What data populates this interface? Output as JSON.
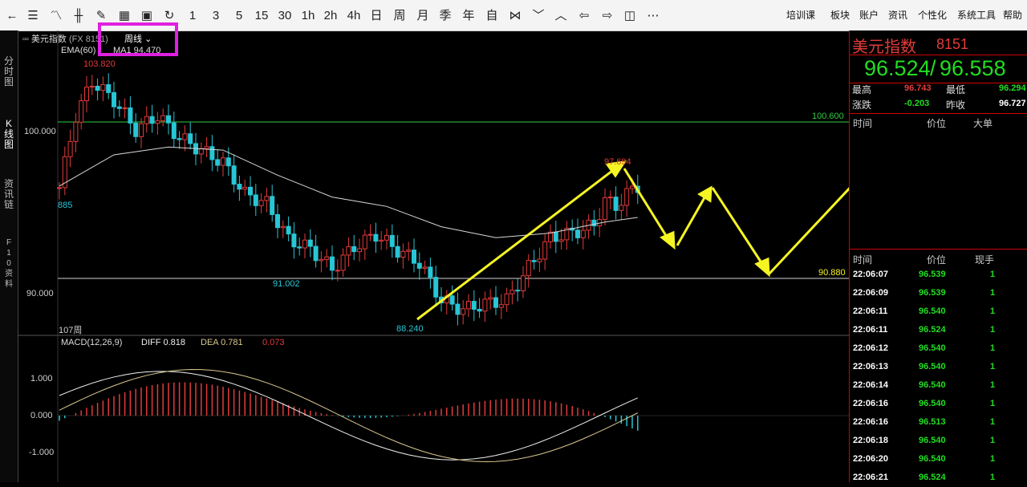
{
  "toolbar": {
    "icons": [
      "back-icon",
      "list-icon",
      "line-icon",
      "candle-icon",
      "draw-icon",
      "layout-icon",
      "save-icon",
      "refresh-icon"
    ],
    "periods": [
      "1",
      "3",
      "5",
      "15",
      "30",
      "1h",
      "2h",
      "4h",
      "日",
      "周",
      "月",
      "季",
      "年",
      "自"
    ],
    "right_menu": [
      "培训课",
      "板块",
      "账户",
      "资讯",
      "个性化",
      "系统工具",
      "帮助"
    ]
  },
  "sidebar": {
    "tabs": [
      "分时图",
      "K线图",
      "资讯链",
      "F10资料"
    ]
  },
  "chart_header": {
    "symbol": "美元指数",
    "code": "(FX 8151)",
    "period": "周线",
    "ema_label": "EMA(60)",
    "ma_label": "MA1 94.470"
  },
  "price_axis": [
    "100.000",
    "90.000"
  ],
  "annotations": {
    "high_label": "103.820",
    "left_label": "885",
    "low1_label": "91.002",
    "low2_label": "88.240",
    "recent_high_label": "97.694",
    "level_high": "100.600",
    "level_low": "90.880",
    "bar_count": "107周"
  },
  "macd": {
    "title": "MACD(12,26,9)",
    "diff": "DIFF 0.818",
    "dea": "DEA 0.781",
    "macd_value": "0.073",
    "axis": [
      "1.000",
      "0.000",
      "-1.000"
    ]
  },
  "quote": {
    "name": "美元指数",
    "code": "8151",
    "bid": "96.524",
    "ask": "96.558",
    "high_label": "最高",
    "high": "96.743",
    "low_label": "最低",
    "low": "96.294",
    "change_label": "涨跌",
    "change": "-0.203",
    "prev_close_label": "昨收",
    "prev_close": "96.727"
  },
  "big_orders": {
    "headers": [
      "时间",
      "价位",
      "大单"
    ]
  },
  "ticks": {
    "headers": [
      "时间",
      "价位",
      "现手"
    ],
    "rows": [
      {
        "time": "22:06:07",
        "price": "96.539",
        "vol": "1"
      },
      {
        "time": "22:06:09",
        "price": "96.539",
        "vol": "1"
      },
      {
        "time": "22:06:11",
        "price": "96.540",
        "vol": "1"
      },
      {
        "time": "22:06:11",
        "price": "96.524",
        "vol": "1"
      },
      {
        "time": "22:06:12",
        "price": "96.540",
        "vol": "1"
      },
      {
        "time": "22:06:13",
        "price": "96.540",
        "vol": "1"
      },
      {
        "time": "22:06:14",
        "price": "96.540",
        "vol": "1"
      },
      {
        "time": "22:06:16",
        "price": "96.540",
        "vol": "1"
      },
      {
        "time": "22:06:16",
        "price": "96.513",
        "vol": "1"
      },
      {
        "time": "22:06:18",
        "price": "96.540",
        "vol": "1"
      },
      {
        "time": "22:06:20",
        "price": "96.540",
        "vol": "1"
      },
      {
        "time": "22:06:21",
        "price": "96.524",
        "vol": "1"
      }
    ]
  },
  "colors": {
    "up": "#e23b3b",
    "down": "#27c6d6",
    "ema": "#d8d8d8",
    "resistance": "#2ecc40",
    "support": "#cfcfcf",
    "arrow": "#f5f523",
    "highlight_box": "#e020e0",
    "quote_green": "#22dd22"
  }
}
